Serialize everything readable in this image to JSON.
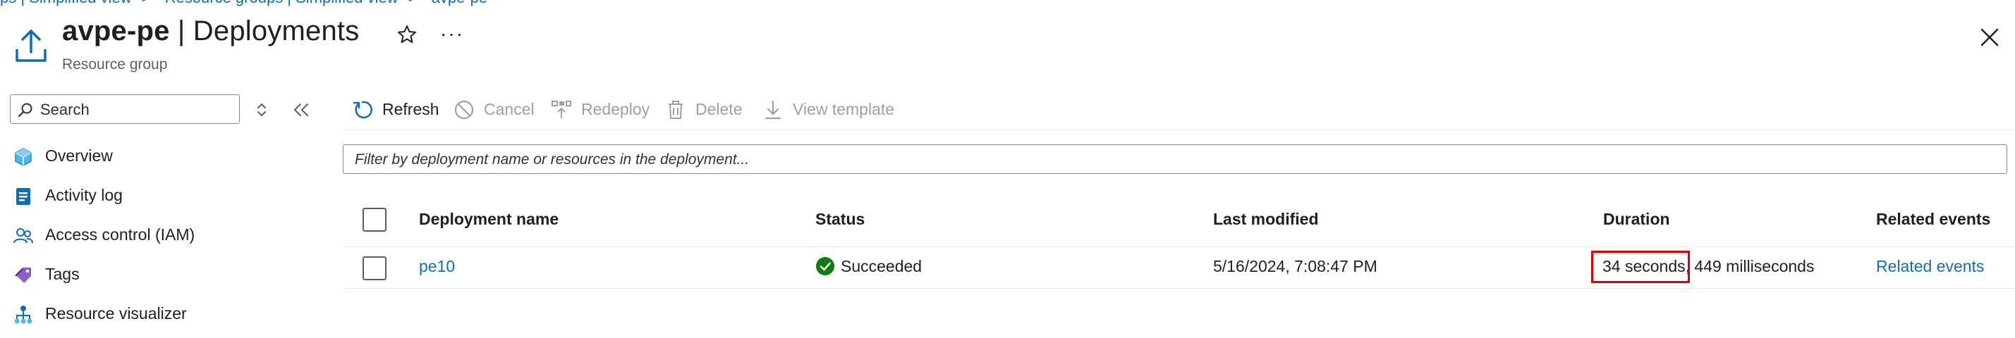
{
  "breadcrumb": {
    "items": [
      "ps | Simplified view",
      "Resource groups | Simplified view",
      "avpe-pe"
    ],
    "separator": ">"
  },
  "header": {
    "title_name": "avpe-pe",
    "title_sep": " | ",
    "title_page": "Deployments",
    "subtitle": "Resource group",
    "icon": "upload-icon",
    "favorite_icon": "star-icon",
    "more_label": "···",
    "close_icon": "close-icon"
  },
  "sidebar": {
    "search": {
      "placeholder": "Search",
      "value": ""
    },
    "items": [
      {
        "label": "Overview",
        "icon": "overview-cube-icon"
      },
      {
        "label": "Activity log",
        "icon": "activity-log-icon"
      },
      {
        "label": "Access control (IAM)",
        "icon": "people-icon"
      },
      {
        "label": "Tags",
        "icon": "tag-icon"
      },
      {
        "label": "Resource visualizer",
        "icon": "hierarchy-icon"
      }
    ]
  },
  "toolbar": {
    "refresh_label": "Refresh",
    "cancel_label": "Cancel",
    "redeploy_label": "Redeploy",
    "delete_label": "Delete",
    "view_template_label": "View template"
  },
  "filter": {
    "placeholder": "Filter by deployment name or resources in the deployment...",
    "value": ""
  },
  "table": {
    "columns": [
      "Deployment name",
      "Status",
      "Last modified",
      "Duration",
      "Related events"
    ],
    "rows": [
      {
        "name": "pe10",
        "status": "Succeeded",
        "last_modified": "5/16/2024, 7:08:47 PM",
        "duration": "34 seconds, 449 milliseconds",
        "related_events": "Related events"
      }
    ]
  },
  "colors": {
    "accent": "#0f6cbd",
    "success": "#107c10",
    "highlight": "#e00000",
    "disabled": "#a19f9d"
  }
}
